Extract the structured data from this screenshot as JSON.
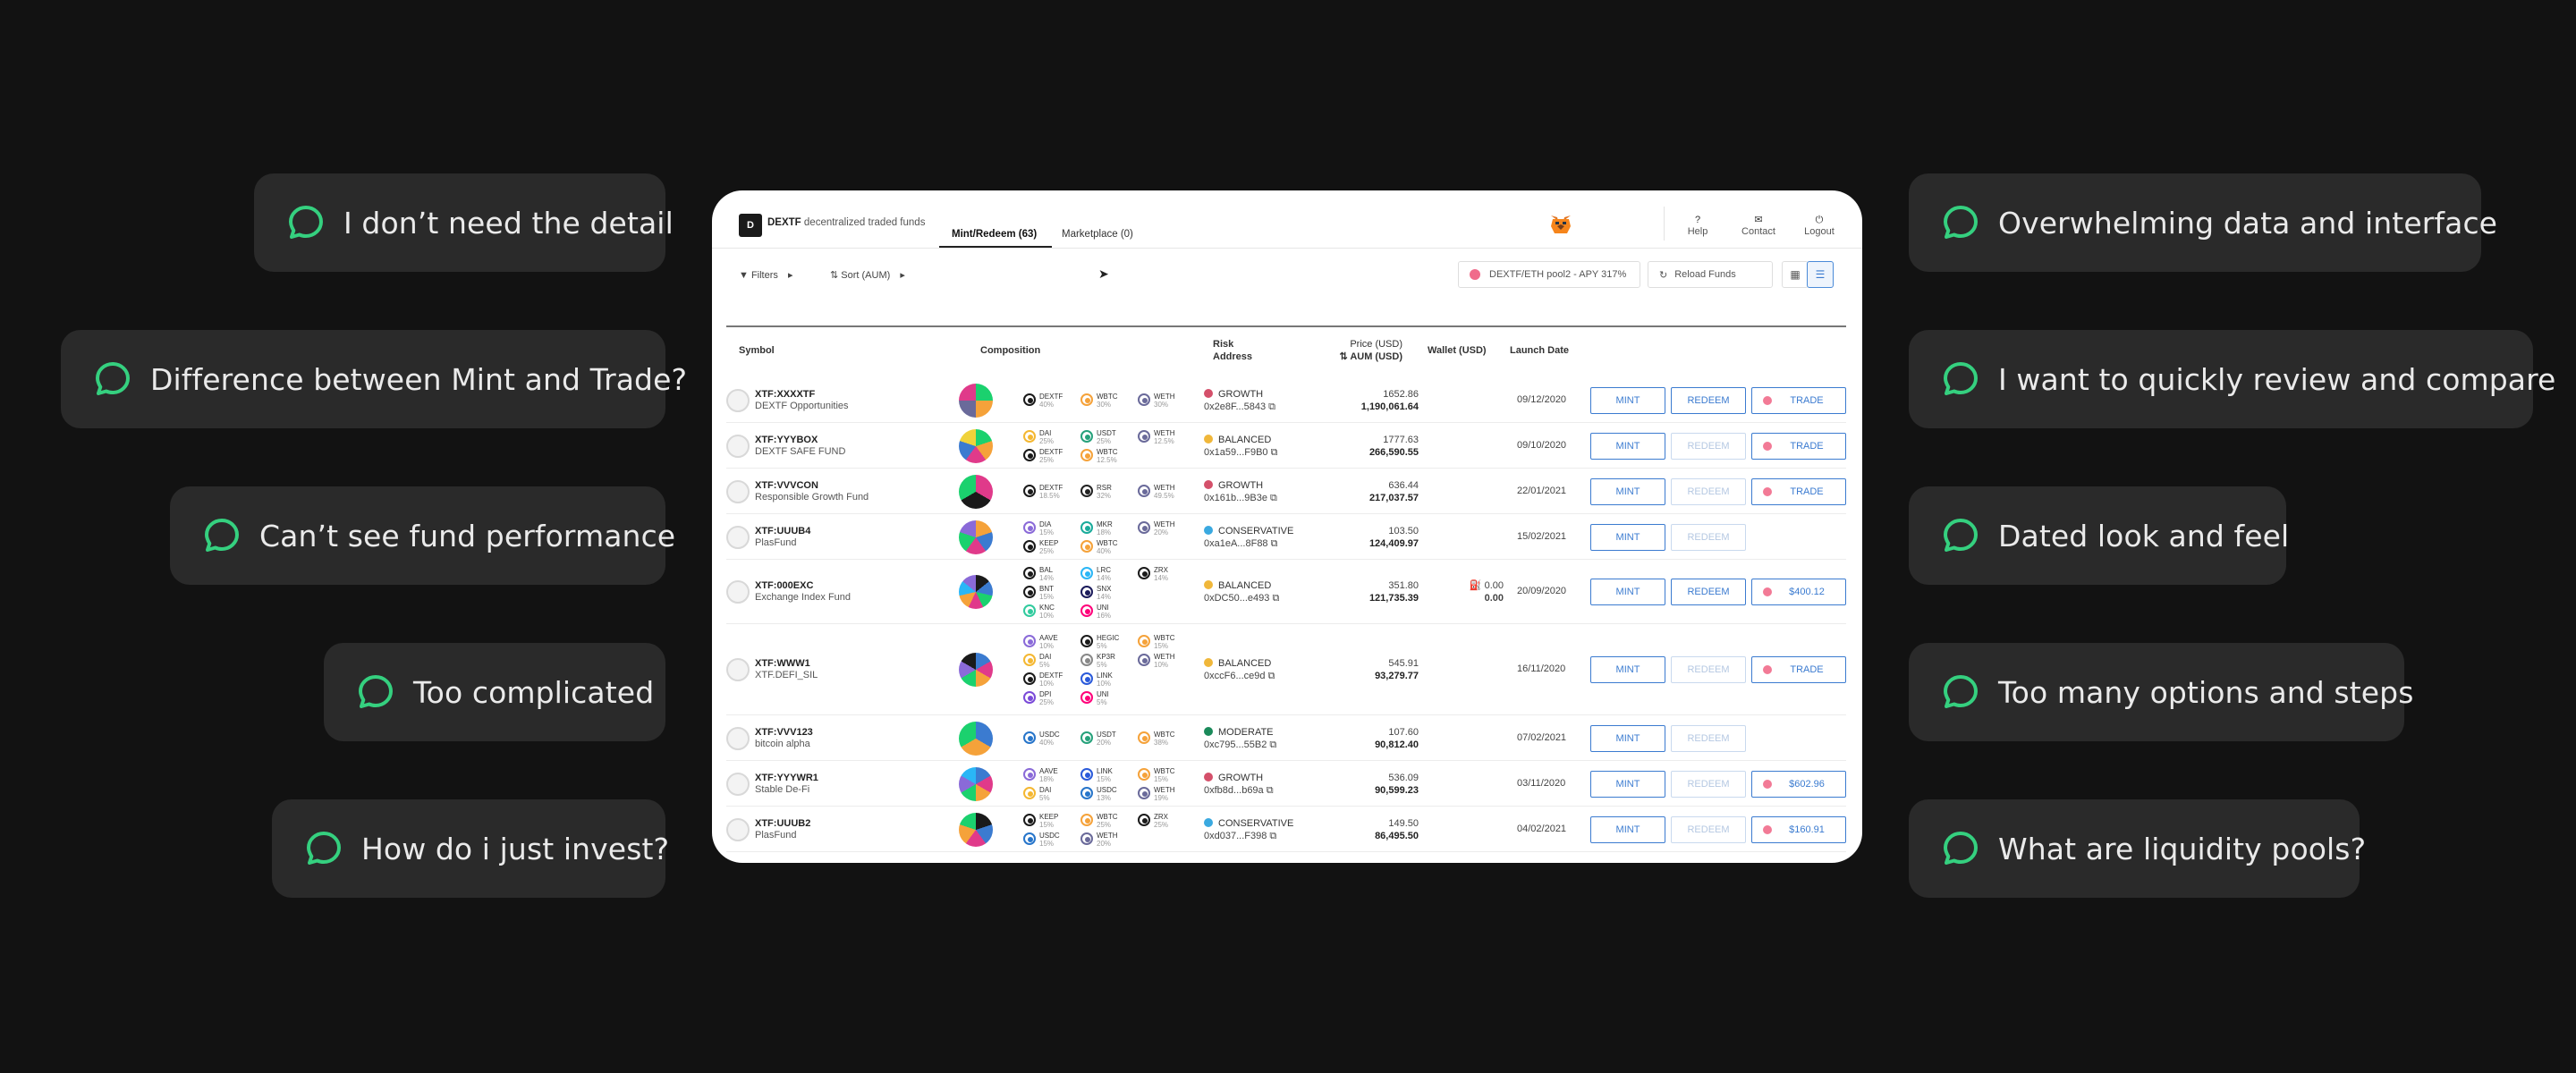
{
  "feedback_left": [
    "I don’t need the detail",
    "Difference between Mint and Trade?",
    "Can’t see fund performance",
    "Too complicated",
    "How do i just invest?"
  ],
  "feedback_right": [
    "Overwhelming data and interface",
    "I want to quickly review and compare",
    "Dated look and feel",
    "Too many options and steps",
    "What are liquidity pools?"
  ],
  "app": {
    "brand": "DEXTF",
    "tagline": "decentralized traded funds",
    "tabs": [
      "Mint/Redeem (63)",
      "Marketplace (0)"
    ],
    "nav": [
      "Help",
      "Contact",
      "Logout"
    ],
    "toolbar": {
      "filters": "Filters",
      "sort": "Sort (AUM)",
      "pool": "DEXTF/ETH pool2 - APY 317%",
      "reload": "Reload Funds"
    },
    "headers": {
      "symbol": "Symbol",
      "composition": "Composition",
      "risk": "Risk",
      "address": "Address",
      "price": "Price (USD)",
      "aum": "AUM (USD)",
      "wallet": "Wallet (USD)",
      "launch": "Launch Date"
    },
    "actions": {
      "mint": "MINT",
      "redeem": "REDEEM",
      "trade": "TRADE"
    },
    "rows": [
      {
        "symbol": "XTF:XXXXTF",
        "name": "DEXTF Opportunities",
        "risk": "GROWTH",
        "risk_color": "#d4506a",
        "address": "0x2e8F...5843",
        "price": "1652.86",
        "aum": "1,190,061.64",
        "wallet": "",
        "wallet2": "",
        "date": "09/12/2020",
        "redeem_enabled": true,
        "trade": "TRADE",
        "coins": [
          {
            "n": "DEXTF",
            "p": "40%",
            "c": "#1a1a1a"
          },
          {
            "n": "WBTC",
            "p": "30%",
            "c": "#f5a23a"
          },
          {
            "n": "WETH",
            "p": "30%",
            "c": "#6a6a9a"
          }
        ],
        "pie": [
          "#1bd16e",
          "#f5a23a",
          "#6a6a9a",
          "#e03a8a"
        ]
      },
      {
        "symbol": "XTF:YYYBOX",
        "name": "DEXTF SAFE FUND",
        "risk": "BALANCED",
        "risk_color": "#f0b73a",
        "address": "0x1a59...F9B0",
        "price": "1777.63",
        "aum": "266,590.55",
        "wallet": "",
        "wallet2": "",
        "date": "09/10/2020",
        "redeem_enabled": false,
        "trade": "TRADE",
        "coins": [
          {
            "n": "DAI",
            "p": "25%",
            "c": "#f4b731"
          },
          {
            "n": "DEXTF",
            "p": "25%",
            "c": "#1a1a1a"
          },
          {
            "n": "USDT",
            "p": "25%",
            "c": "#26a17b"
          },
          {
            "n": "WBTC",
            "p": "12.5%",
            "c": "#f5a23a"
          },
          {
            "n": "WETH",
            "p": "12.5%",
            "c": "#6a6a9a"
          }
        ],
        "pie": [
          "#1bd16e",
          "#f5a23a",
          "#e03a8a",
          "#3b7bd0",
          "#f0d23a"
        ]
      },
      {
        "symbol": "XTF:VVVCON",
        "name": "Responsible Growth Fund",
        "risk": "GROWTH",
        "risk_color": "#d4506a",
        "address": "0x161b...9B3e",
        "price": "636.44",
        "aum": "217,037.57",
        "wallet": "",
        "wallet2": "",
        "date": "22/01/2021",
        "redeem_enabled": false,
        "trade": "TRADE",
        "coins": [
          {
            "n": "DEXTF",
            "p": "18.5%",
            "c": "#1a1a1a"
          },
          {
            "n": "RSR",
            "p": "32%",
            "c": "#222"
          },
          {
            "n": "WETH",
            "p": "49.5%",
            "c": "#6a6a9a"
          }
        ],
        "pie": [
          "#e03a8a",
          "#1a1a1a",
          "#1bd16e"
        ]
      },
      {
        "symbol": "XTF:UUUB4",
        "name": "PlasFund",
        "risk": "CONSERVATIVE",
        "risk_color": "#3aa9e0",
        "address": "0xa1eA...8F88",
        "price": "103.50",
        "aum": "124,409.97",
        "wallet": "",
        "wallet2": "",
        "date": "15/02/2021",
        "redeem_enabled": false,
        "trade": "",
        "coins": [
          {
            "n": "DIA",
            "p": "15%",
            "c": "#8a6ad8"
          },
          {
            "n": "KEEP",
            "p": "25%",
            "c": "#1a1a1a"
          },
          {
            "n": "MKR",
            "p": "18%",
            "c": "#1aab9b"
          },
          {
            "n": "WBTC",
            "p": "40%",
            "c": "#f5a23a"
          },
          {
            "n": "WETH",
            "p": "20%",
            "c": "#6a6a9a"
          }
        ],
        "pie": [
          "#f5a23a",
          "#3b7bd0",
          "#e03a8a",
          "#1bd16e",
          "#8a6ad8"
        ]
      },
      {
        "symbol": "XTF:000EXC",
        "name": "Exchange Index Fund",
        "risk": "BALANCED",
        "risk_color": "#f0b73a",
        "address": "0xDC50...e493",
        "price": "351.80",
        "aum": "121,735.39",
        "wallet": "0.00",
        "wallet2": "0.00",
        "date": "20/09/2020",
        "redeem_enabled": true,
        "trade": "$400.12",
        "coins": [
          {
            "n": "BAL",
            "p": "14%",
            "c": "#1a1a1a"
          },
          {
            "n": "BNT",
            "p": "15%",
            "c": "#1a1a1a"
          },
          {
            "n": "KNC",
            "p": "10%",
            "c": "#31cb9e"
          },
          {
            "n": "LRC",
            "p": "14%",
            "c": "#2ab6f6"
          },
          {
            "n": "SNX",
            "p": "14%",
            "c": "#1a1a5a"
          },
          {
            "n": "UNI",
            "p": "16%",
            "c": "#ff007a"
          },
          {
            "n": "ZRX",
            "p": "14%",
            "c": "#1a1a1a"
          }
        ],
        "pie": [
          "#1a1a1a",
          "#3b7bd0",
          "#1bd16e",
          "#e03a8a",
          "#f5a23a",
          "#2ab6f6",
          "#8a6ad8"
        ]
      },
      {
        "symbol": "XTF:WWW1",
        "name": "XTF.DEFI_SIL",
        "risk": "BALANCED",
        "risk_color": "#f0b73a",
        "address": "0xccF6...ce9d",
        "price": "545.91",
        "aum": "93,279.77",
        "wallet": "",
        "wallet2": "",
        "date": "16/11/2020",
        "redeem_enabled": false,
        "trade": "TRADE",
        "coins": [
          {
            "n": "AAVE",
            "p": "10%",
            "c": "#8a6ad8"
          },
          {
            "n": "DAI",
            "p": "5%",
            "c": "#f4b731"
          },
          {
            "n": "DEXTF",
            "p": "10%",
            "c": "#1a1a1a"
          },
          {
            "n": "DPI",
            "p": "25%",
            "c": "#7a4ad8"
          },
          {
            "n": "HEGIC",
            "p": "5%",
            "c": "#1a1a1a"
          },
          {
            "n": "KP3R",
            "p": "5%",
            "c": "#888"
          },
          {
            "n": "LINK",
            "p": "10%",
            "c": "#2a5ada"
          },
          {
            "n": "UNI",
            "p": "5%",
            "c": "#ff007a"
          },
          {
            "n": "WBTC",
            "p": "15%",
            "c": "#f5a23a"
          },
          {
            "n": "WETH",
            "p": "10%",
            "c": "#6a6a9a"
          }
        ],
        "pie": [
          "#3b7bd0",
          "#e03a8a",
          "#f5a23a",
          "#1bd16e",
          "#8a6ad8",
          "#1a1a1a"
        ]
      },
      {
        "symbol": "XTF:VVV123",
        "name": "bitcoin alpha",
        "risk": "MODERATE",
        "risk_color": "#1a8a5a",
        "address": "0xc795...55B2",
        "price": "107.60",
        "aum": "90,812.40",
        "wallet": "",
        "wallet2": "",
        "date": "07/02/2021",
        "redeem_enabled": false,
        "trade": "",
        "coins": [
          {
            "n": "USDC",
            "p": "40%",
            "c": "#2775ca"
          },
          {
            "n": "USDT",
            "p": "20%",
            "c": "#26a17b"
          },
          {
            "n": "WBTC",
            "p": "38%",
            "c": "#f5a23a"
          }
        ],
        "pie": [
          "#3b7bd0",
          "#f5a23a",
          "#1bd16e"
        ]
      },
      {
        "symbol": "XTF:YYYWR1",
        "name": "Stable De-Fi",
        "risk": "GROWTH",
        "risk_color": "#d4506a",
        "address": "0xfb8d...b69a",
        "price": "536.09",
        "aum": "90,599.23",
        "wallet": "",
        "wallet2": "",
        "date": "03/11/2020",
        "redeem_enabled": false,
        "trade": "$602.96",
        "coins": [
          {
            "n": "AAVE",
            "p": "18%",
            "c": "#8a6ad8"
          },
          {
            "n": "DAI",
            "p": "5%",
            "c": "#f4b731"
          },
          {
            "n": "LINK",
            "p": "15%",
            "c": "#2a5ada"
          },
          {
            "n": "USDC",
            "p": "13%",
            "c": "#2775ca"
          },
          {
            "n": "WBTC",
            "p": "15%",
            "c": "#f5a23a"
          },
          {
            "n": "WETH",
            "p": "19%",
            "c": "#6a6a9a"
          }
        ],
        "pie": [
          "#3b7bd0",
          "#e03a8a",
          "#f5a23a",
          "#1bd16e",
          "#8a6ad8",
          "#2ab6f6"
        ]
      },
      {
        "symbol": "XTF:UUUB2",
        "name": "PlasFund",
        "risk": "CONSERVATIVE",
        "risk_color": "#3aa9e0",
        "address": "0xd037...F398",
        "price": "149.50",
        "aum": "86,495.50",
        "wallet": "",
        "wallet2": "",
        "date": "04/02/2021",
        "redeem_enabled": false,
        "trade": "$160.91",
        "coins": [
          {
            "n": "KEEP",
            "p": "15%",
            "c": "#1a1a1a"
          },
          {
            "n": "USDC",
            "p": "15%",
            "c": "#2775ca"
          },
          {
            "n": "WBTC",
            "p": "25%",
            "c": "#f5a23a"
          },
          {
            "n": "WETH",
            "p": "20%",
            "c": "#6a6a9a"
          },
          {
            "n": "ZRX",
            "p": "25%",
            "c": "#1a1a1a"
          }
        ],
        "pie": [
          "#1a1a1a",
          "#3b7bd0",
          "#e03a8a",
          "#f5a23a",
          "#1bd16e"
        ]
      }
    ]
  },
  "colors": {
    "accent": "#3b7bd0",
    "bubble_icon": "#35d07f",
    "background": "#121212"
  }
}
